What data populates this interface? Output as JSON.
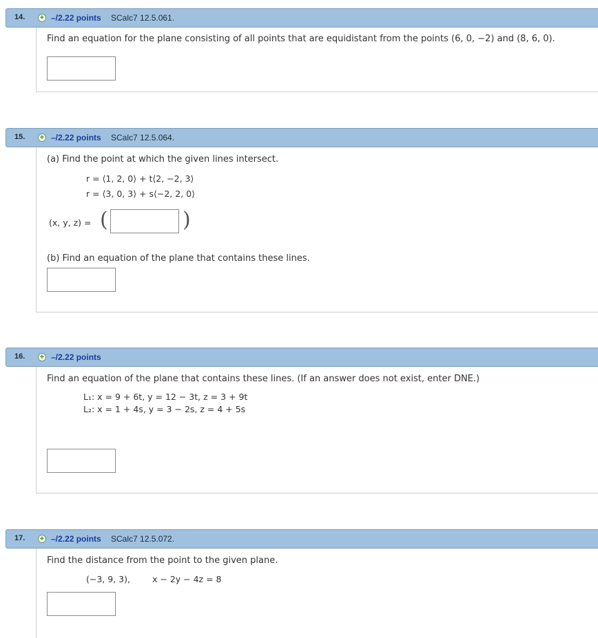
{
  "q14": {
    "number": "14.",
    "points": "–/2.22 points",
    "source": "SCalc7 12.5.061.",
    "prompt": "Find an equation for the plane consisting of all points that are equidistant from the points  (6, 0, −2) and (8, 6, 0)."
  },
  "q15": {
    "number": "15.",
    "points": "–/2.22 points",
    "source": "SCalc7 12.5.064.",
    "part_a": "(a) Find the point at which the given lines intersect.",
    "line1": "r = ⟨1, 2, 0⟩  +  t⟨2, −2, 3⟩",
    "line2": "r = ⟨3, 0, 3⟩  +  s⟨−2, 2, 0⟩",
    "xyz_label": "(x, y, z) =",
    "part_b": "(b) Find an equation of the plane that contains these lines."
  },
  "q16": {
    "number": "16.",
    "points": "–/2.22 points",
    "prompt": "Find an equation of the plane that contains these lines. (If an answer does not exist, enter DNE.)",
    "l1": "L₁: x = 9 + 6t,  y = 12 − 3t,  z = 3 + 9t",
    "l2": "L₂: x = 1 + 4s,  y = 3 − 2s,  z = 4 + 5s"
  },
  "q17": {
    "number": "17.",
    "points": "–/2.22 points",
    "source": "SCalc7 12.5.072.",
    "prompt": "Find the distance from the point to the given plane.",
    "point": "(−3, 9, 3),",
    "plane": "x − 2y − 4z = 8"
  },
  "icons": {
    "expand": "plus-circle-icon"
  },
  "colors": {
    "header_bg": "#9fc1df",
    "points": "#1a3d9c",
    "plus": "#2e8b1e"
  }
}
